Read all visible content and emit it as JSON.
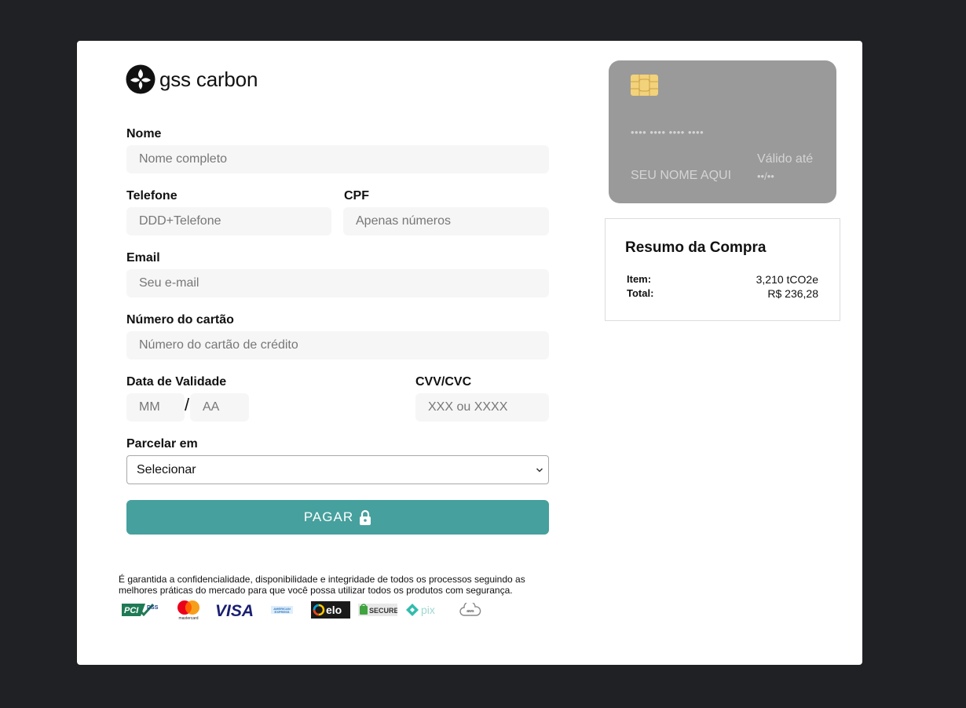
{
  "brand": {
    "name_part1": "gss",
    "name_part2": "carbon"
  },
  "form": {
    "name_label": "Nome",
    "name_placeholder": "Nome completo",
    "phone_label": "Telefone",
    "phone_placeholder": "DDD+Telefone",
    "cpf_label": "CPF",
    "cpf_placeholder": "Apenas números",
    "email_label": "Email",
    "email_placeholder": "Seu e-mail",
    "card_label": "Número do cartão",
    "card_placeholder": "Número do cartão de crédito",
    "expiry_label": "Data de Validade",
    "month_placeholder": "MM",
    "expiry_separator": "/",
    "year_placeholder": "AA",
    "cvv_label": "CVV/CVC",
    "cvv_placeholder": "XXX ou XXXX",
    "installments_label": "Parcelar em",
    "installments_selected": "Selecionar",
    "pay_label": "PAGAR"
  },
  "security_note": "É garantida a confidencialidade, disponibilidade e integridade de todos os processos seguindo as melhores práticas do mercado para que você possa utilizar todos os produtos com segurança.",
  "badges": {
    "pci": "PCI DSS",
    "mastercard": "mastercard",
    "visa": "VISA",
    "amex": "AMERICAN EXPRESS",
    "elo": "elo",
    "secure": "SECURE",
    "pix": "pix",
    "aws": "aws"
  },
  "card_preview": {
    "number": "•••• •••• •••• ••••",
    "holder": "SEU NOME AQUI",
    "valid_label": "Válido até",
    "valid_value": "••/••"
  },
  "summary": {
    "title": "Resumo da Compra",
    "item_label": "Item:",
    "item_value": "3,210 tCO2e",
    "total_label": "Total:",
    "total_value": "R$ 236,28"
  },
  "colors": {
    "background": "#202124",
    "accent": "#46a09d",
    "card": "#9a9a9a",
    "chip": "#f2d27a"
  }
}
